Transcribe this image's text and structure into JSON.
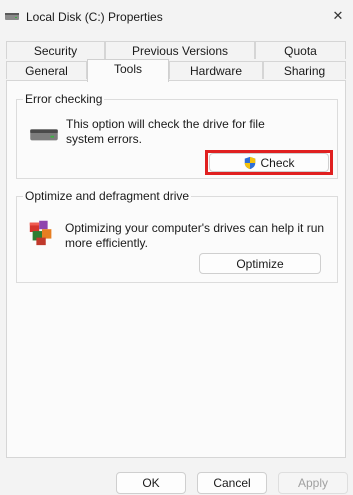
{
  "window": {
    "title": "Local Disk (C:) Properties",
    "close_glyph": "✕"
  },
  "tabs": {
    "row_top": [
      "Security",
      "Previous Versions",
      "Quota"
    ],
    "row_bottom": [
      "General",
      "Tools",
      "Hardware",
      "Sharing"
    ],
    "active": "Tools"
  },
  "error_checking": {
    "title": "Error checking",
    "description": "This option will check the drive for file system errors.",
    "button_label": "Check",
    "icon": "drive-icon",
    "button_icon": "shield-icon",
    "highlight_color": "#e02020"
  },
  "optimize": {
    "title": "Optimize and defragment drive",
    "description": "Optimizing your computer's drives can help it run more efficiently.",
    "button_label": "Optimize",
    "icon": "defrag-icon"
  },
  "footer": {
    "ok_label": "OK",
    "cancel_label": "Cancel",
    "apply_label": "Apply",
    "apply_disabled": true
  }
}
